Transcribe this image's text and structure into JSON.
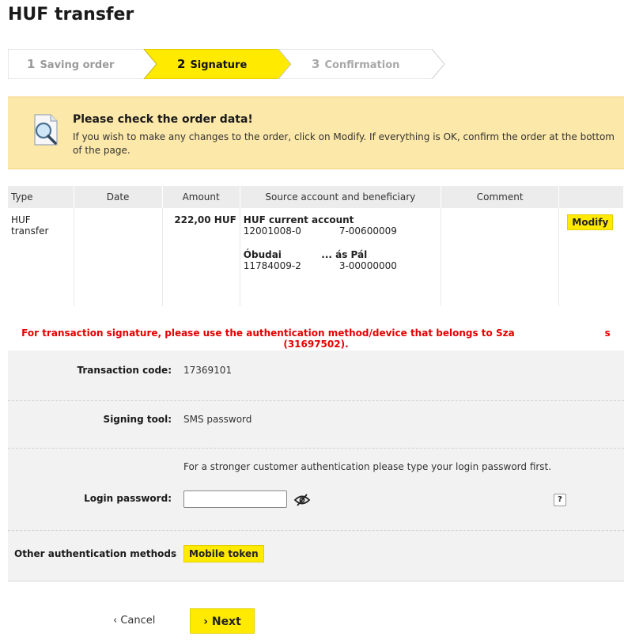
{
  "page": {
    "title": "HUF transfer"
  },
  "steps": [
    {
      "num": "1",
      "label": "Saving order",
      "state": "done"
    },
    {
      "num": "2",
      "label": "Signature",
      "state": "active"
    },
    {
      "num": "3",
      "label": "Confirmation",
      "state": "todo"
    }
  ],
  "notice": {
    "icon": "magnifier-document-icon",
    "title": "Please check the order data!",
    "text": "If you wish to make any changes to the order, click on Modify. If everything is OK, confirm the order at the bottom of the page."
  },
  "order_table": {
    "headers": [
      "Type",
      "Date",
      "Amount",
      "Source account and beneficiary",
      "Comment",
      ""
    ],
    "row": {
      "type": "HUF transfer",
      "date": "",
      "amount": "222,00 HUF",
      "source_name": "HUF current account",
      "source_number": "12001008-0        7-00600009",
      "beneficiary_name": "Óbudai         ... ás Pál",
      "beneficiary_number": "11784009-2        3-00000000",
      "comment": "",
      "modify_label": "Modify"
    }
  },
  "warning": "For transaction signature, please use the authentication method/device that belongs to Sza                   s (31697502).",
  "form": {
    "transaction_code_label": "Transaction code:",
    "transaction_code": "17369101",
    "signing_tool_label": "Signing tool:",
    "signing_tool": "SMS password",
    "hint": "For a stronger customer authentication please type your login password first.",
    "login_password_label": "Login password:",
    "login_password_value": "",
    "help_label": "?",
    "other_methods_label": "Other authentication methods",
    "mobile_token_label": "Mobile token"
  },
  "footer": {
    "cancel_label": "‹ Cancel",
    "next_label": "› Next"
  },
  "colors": {
    "accent": "#ffea00",
    "notice_bg": "#fce8a9",
    "warning": "#e60000"
  }
}
